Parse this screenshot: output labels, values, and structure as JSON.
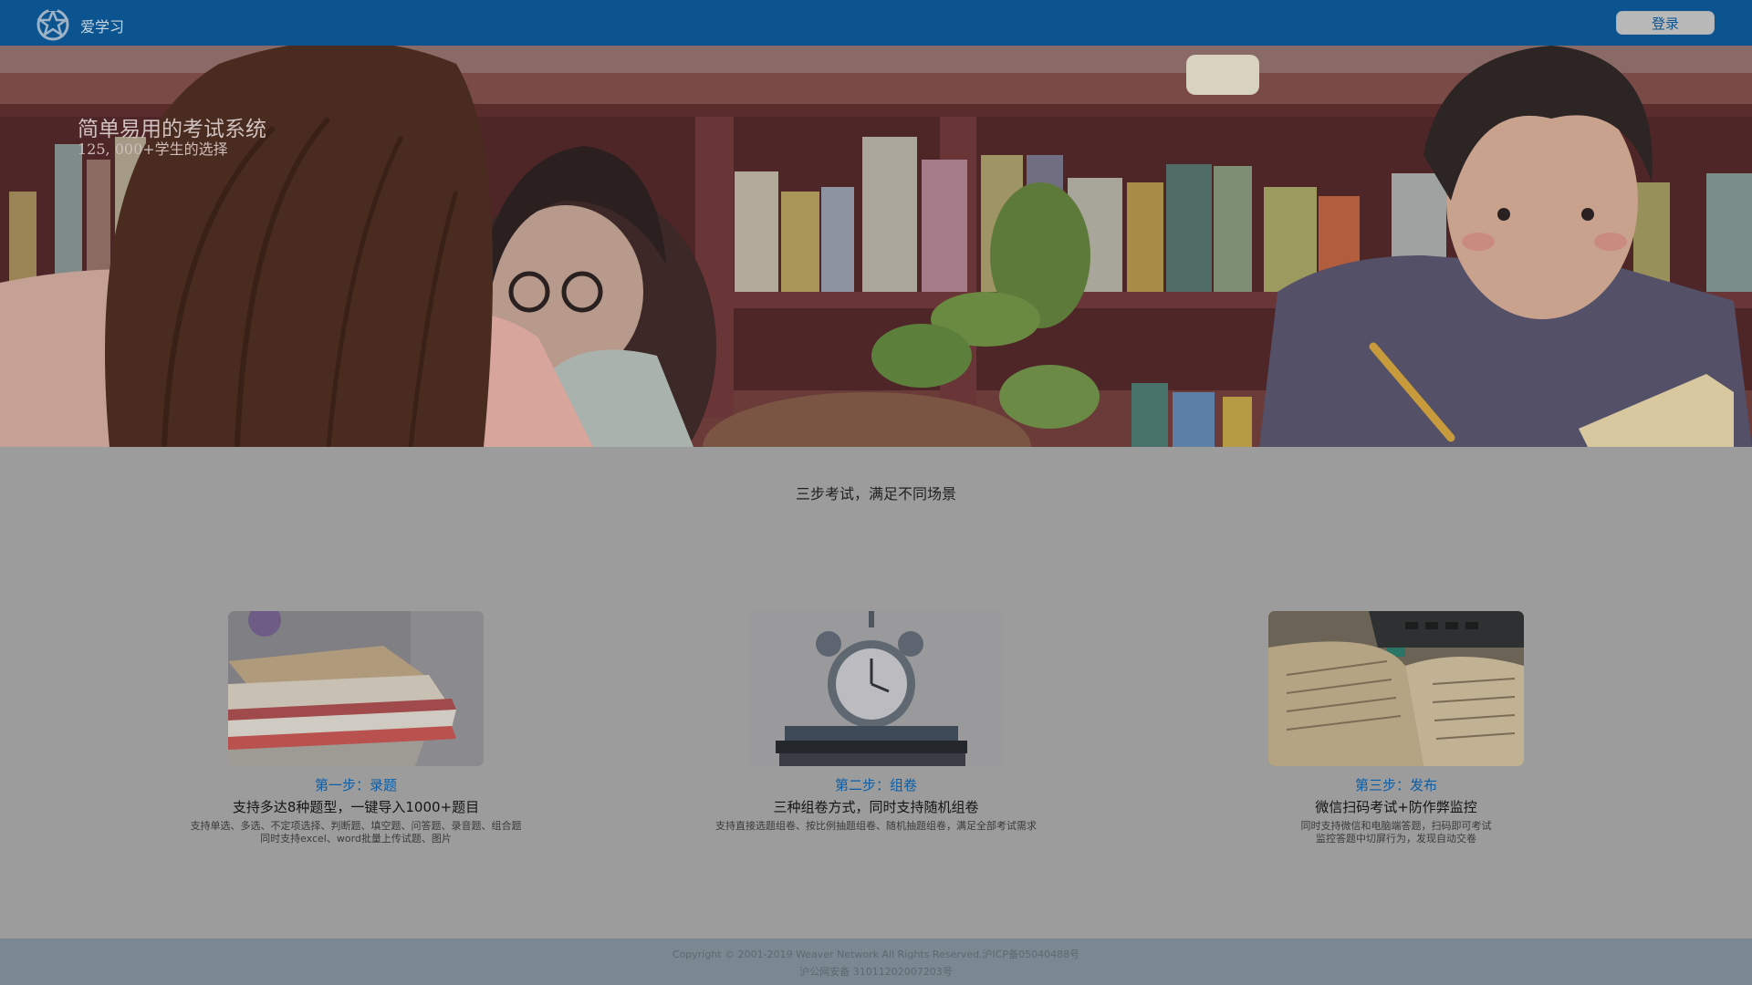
{
  "header": {
    "brand": "爱学习",
    "login_label": "登录",
    "logo_icon": "star-crest-icon"
  },
  "hero": {
    "title": "简单易用的考试系统",
    "subtitle": "125, 000+学生的选择"
  },
  "section": {
    "title": "三步考试，满足不同场景"
  },
  "steps": [
    {
      "label": "第一步：录题",
      "heading": "支持多达8种题型，一键导入1000+题目",
      "desc": "支持单选、多选、不定项选择、判断题、填空题、问答题、录音题、组合题\n同时支持excel、word批量上传试题、图片"
    },
    {
      "label": "第二步：组卷",
      "heading": "三种组卷方式，同时支持随机组卷",
      "desc": "支持直接选题组卷、按比例抽题组卷、随机抽题组卷，满足全部考试需求"
    },
    {
      "label": "第三步：发布",
      "heading": "微信扫码考试+防作弊监控",
      "desc": "同时支持微信和电脑端答题，扫码即可考试\n监控答题中切屏行为，发现自动交卷"
    }
  ],
  "footer": {
    "line1": "Copyright © 2001-2019 Weaver Network All Rights Reserved.沪ICP备05040488号",
    "line2": "沪公网安备 31011202007203号"
  },
  "colors": {
    "header": "#0b5490",
    "accent": "#0b5ea6",
    "page_bg": "#9c9c9c",
    "footer": "#7b8891"
  }
}
